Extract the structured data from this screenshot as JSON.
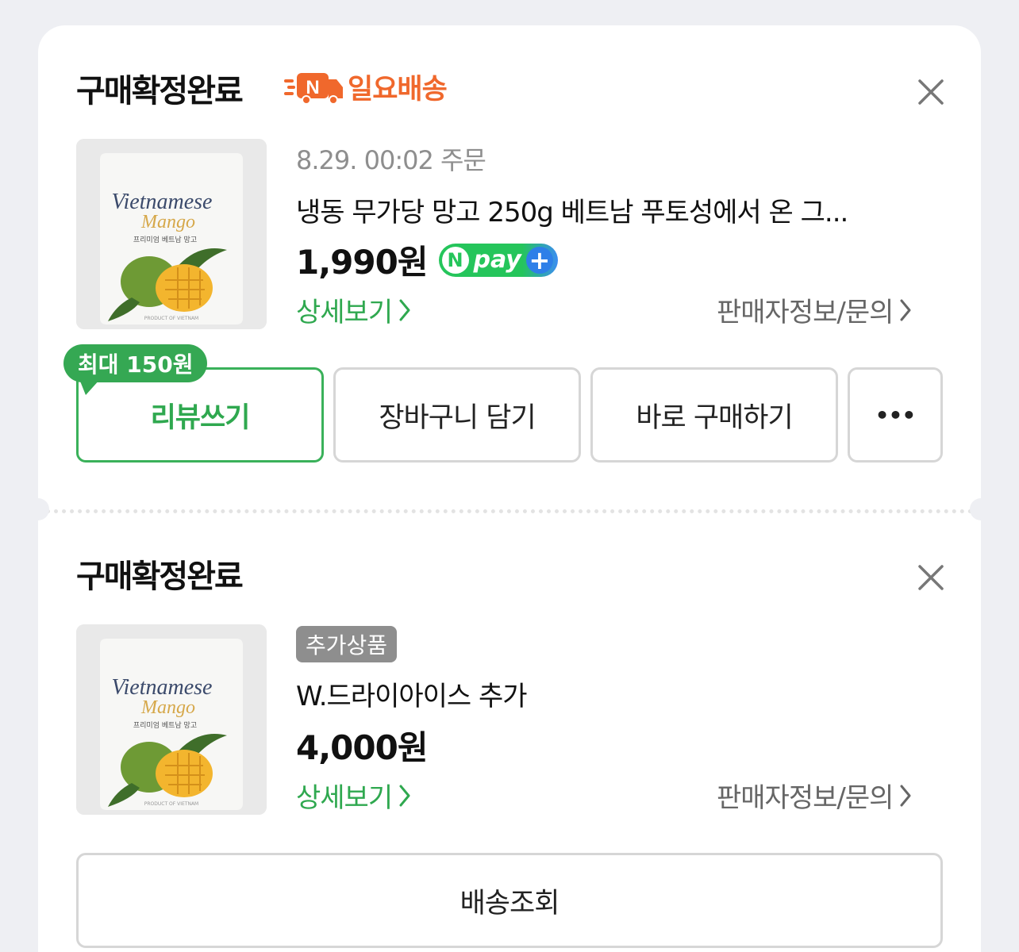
{
  "orders": [
    {
      "status": "구매확정완료",
      "delivery_badge": {
        "letter": "N",
        "label": "일요배송"
      },
      "date": "8.29. 00:02 주문",
      "product_name": "냉동 무가당 망고 250g 베트남 푸토성에서 온 그...",
      "price": "1,990원",
      "npay": {
        "n": "N",
        "text": "pay",
        "plus": "+"
      },
      "detail_link": "상세보기",
      "seller_link": "판매자정보/문의",
      "review_tooltip": "최대 150원",
      "buttons": {
        "review": "리뷰쓰기",
        "cart": "장바구니 담기",
        "buy_now": "바로 구매하기",
        "more": "•••"
      },
      "thumbnail": {
        "brand_line1": "Vietnamese",
        "brand_line2": "Mango",
        "subtitle": "프리미엄 베트남 망고",
        "footer": "PRODUCT OF VIETNAM"
      }
    },
    {
      "status": "구매확정완료",
      "badge": "추가상품",
      "product_name": "W.드라이아이스 추가",
      "price": "4,000원",
      "detail_link": "상세보기",
      "seller_link": "판매자정보/문의",
      "buttons": {
        "tracking": "배송조회"
      },
      "thumbnail": {
        "brand_line1": "Vietnamese",
        "brand_line2": "Mango",
        "subtitle": "프리미엄 베트남 망고",
        "footer": "PRODUCT OF VIETNAM"
      }
    }
  ],
  "colors": {
    "accent_green": "#2fa84f",
    "sunday_orange": "#f0682c",
    "npay_blue": "#2e7fe8",
    "text": "#111111",
    "muted": "#8e8e8e"
  }
}
